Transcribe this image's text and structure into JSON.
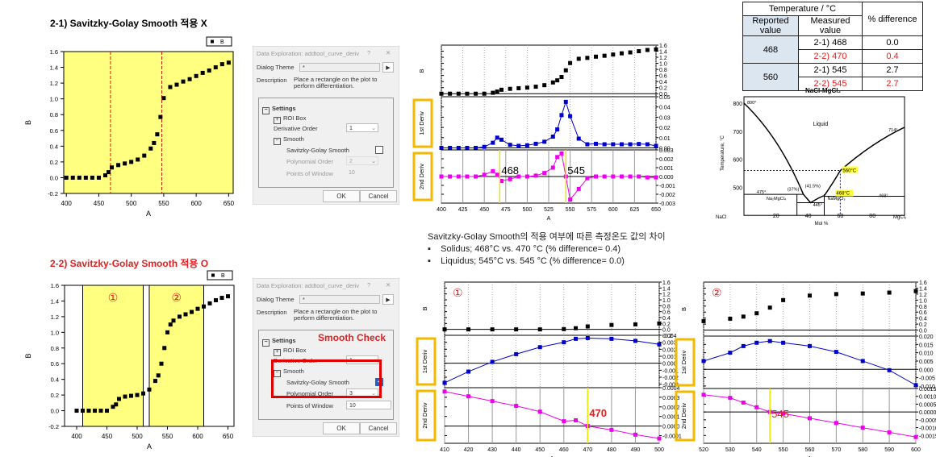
{
  "section1": {
    "title": "2-1) Savitzky-Golay  Smooth 적용 X"
  },
  "section2": {
    "title": "2-2) Savitzky-Golay  Smooth 적용 O"
  },
  "dialog1": {
    "title": "Data Exploration: addtool_curve_deriv",
    "help": "?",
    "close": "✕",
    "theme_label": "Dialog Theme",
    "theme_value": "*",
    "description_label": "Description",
    "description": "Place a rectangle on the plot to perform differentiation.",
    "settings": "Settings",
    "roi": "ROI Box",
    "deriv_label": "Derivative Order",
    "deriv_value": "1",
    "smooth": "Smooth",
    "sg_label": "Savitzky-Golay Smooth",
    "sg_checked": false,
    "poly_label": "Polynomial Order",
    "poly_value": "2",
    "window_label": "Points of Window",
    "window_value": "10",
    "ok": "OK",
    "cancel": "Cancel"
  },
  "dialog2": {
    "title": "Data Exploration: addtool_curve_deriv",
    "help": "?",
    "close": "✕",
    "theme_label": "Dialog Theme",
    "theme_value": "*",
    "description_label": "Description",
    "description": "Place a rectangle on the plot to perform differentiation.",
    "settings": "Settings",
    "roi": "ROI Box",
    "deriv_label": "Derivative Order",
    "deriv_value": "1",
    "smooth": "Smooth",
    "sg_label": "Savitzky-Golay Smooth",
    "sg_checked": true,
    "poly_label": "Polynomial Order",
    "poly_value": "3",
    "window_label": "Points of Window",
    "window_value": "10",
    "ok": "OK",
    "cancel": "Cancel",
    "annotation": "Smooth Check"
  },
  "notes": {
    "heading": "Savitzky-Golay Smooth의 적용 여부에 따른 측정온도 값의 차이",
    "items": [
      "Solidus; 468°C vs. 470 °C (% difference= 0.4)",
      "Liquidus; 545°C vs. 545 °C (% difference= 0.0)"
    ]
  },
  "table": {
    "header": "Temperature / °C",
    "col_reported": "Reported value",
    "col_measured": "Measured value",
    "col_diff": "% difference",
    "rows": [
      {
        "reported": "468",
        "measured": [
          "2-1) 468",
          "2-2) 470"
        ],
        "diff": [
          "0.0",
          "0.4"
        ]
      },
      {
        "reported": "560",
        "measured": [
          "2-1) 545",
          "2-2) 545"
        ],
        "diff": [
          "2.7",
          "2.7"
        ]
      }
    ]
  },
  "phase": {
    "title": "NaCl-MgCl₂",
    "ylabel": "Temperature, °C",
    "xlabel": "Mol %",
    "left": "NaCl",
    "right": "MgCl₂",
    "yticks": [
      "800",
      "700",
      "600",
      "500"
    ],
    "xticks": [
      "20",
      "40",
      "60",
      "80"
    ],
    "liquid": "Liquid",
    "labels": [
      "800°",
      "714°",
      "475°",
      "(37%)",
      "(41.5%)",
      "445°",
      "468°",
      "Na₂MgCl₄",
      "NaMgCl₃"
    ],
    "mark_liq": "560°C",
    "mark_sol": "468°C",
    "mark_color": "#ffff33",
    "guide_color": "#0000ff"
  },
  "colors": {
    "yellow": "#ffff80",
    "black": "#000000",
    "blue": "#0000cc",
    "magenta": "#ee00ee",
    "red": "#e02020",
    "orange": "#f5b800"
  },
  "chart_data": [
    {
      "id": "c1",
      "type": "scatter",
      "xlabel": "A",
      "ylabel": "B",
      "legend": "B",
      "xlim": [
        396,
        657
      ],
      "ylim": [
        -0.2,
        1.6
      ],
      "xticks": [
        400,
        450,
        500,
        550,
        600,
        650
      ],
      "yticks": [
        "-0.2",
        "0.0",
        "0.2",
        "0.4",
        "0.6",
        "0.8",
        "1.0",
        "1.2",
        "1.4",
        "1.6"
      ],
      "x": [
        400,
        410,
        420,
        430,
        440,
        450,
        460,
        465,
        470,
        480,
        490,
        500,
        510,
        520,
        530,
        535,
        540,
        545,
        550,
        560,
        570,
        580,
        590,
        600,
        610,
        620,
        630,
        640,
        650
      ],
      "y": [
        0,
        0,
        0,
        0,
        0,
        0,
        0.03,
        0.07,
        0.13,
        0.16,
        0.18,
        0.2,
        0.23,
        0.28,
        0.37,
        0.44,
        0.55,
        0.77,
        1.01,
        1.15,
        1.18,
        1.22,
        1.25,
        1.29,
        1.33,
        1.36,
        1.4,
        1.44,
        1.46
      ],
      "vlines": [
        468,
        547
      ]
    },
    {
      "id": "c2",
      "type": "scatter",
      "xlabel": "A",
      "ylabel": "B",
      "legend": "B",
      "xlim": [
        380,
        660
      ],
      "ylim": [
        -0.2,
        1.6
      ],
      "xticks": [
        400,
        450,
        500,
        550,
        600,
        650
      ],
      "yticks": [
        "-0.2",
        "0.0",
        "0.2",
        "0.4",
        "0.6",
        "0.8",
        "1.0",
        "1.2",
        "1.4",
        "1.6"
      ],
      "x": [
        400,
        410,
        420,
        430,
        440,
        450,
        460,
        465,
        470,
        480,
        490,
        500,
        510,
        520,
        530,
        535,
        540,
        545,
        550,
        555,
        560,
        570,
        580,
        590,
        600,
        610,
        620,
        630,
        640,
        650
      ],
      "y": [
        0,
        0,
        0,
        0,
        0,
        0,
        0.05,
        0.08,
        0.15,
        0.18,
        0.19,
        0.2,
        0.22,
        0.27,
        0.38,
        0.45,
        0.6,
        0.8,
        1.0,
        1.1,
        1.15,
        1.2,
        1.23,
        1.26,
        1.3,
        1.33,
        1.37,
        1.41,
        1.44,
        1.46
      ],
      "regions": [
        [
          410,
          510
        ],
        [
          520,
          610
        ]
      ],
      "region_labels": [
        "①",
        "②"
      ]
    },
    {
      "id": "c3",
      "type": "line",
      "xlabel": "A",
      "xlim": [
        400,
        650
      ],
      "xticks": [
        400,
        425,
        450,
        475,
        500,
        525,
        550,
        575,
        600,
        625,
        650
      ],
      "x": [
        400,
        410,
        420,
        430,
        440,
        450,
        460,
        465,
        470,
        480,
        490,
        500,
        510,
        520,
        530,
        535,
        540,
        545,
        550,
        560,
        570,
        580,
        590,
        600,
        610,
        620,
        630,
        640,
        650
      ],
      "panels": [
        {
          "ylabel": "B",
          "ylim": [
            -0.1,
            1.6
          ],
          "yticks": [
            0,
            0.2,
            0.4,
            0.6,
            0.8,
            1.0,
            1.2,
            1.4,
            1.6
          ],
          "fmt": 1,
          "line": false,
          "color": "#000000",
          "y": [
            0,
            0,
            0,
            0,
            0,
            0,
            0.03,
            0.07,
            0.13,
            0.16,
            0.18,
            0.2,
            0.23,
            0.28,
            0.37,
            0.44,
            0.55,
            0.77,
            1.01,
            1.15,
            1.18,
            1.22,
            1.25,
            1.29,
            1.33,
            1.36,
            1.4,
            1.44,
            1.46
          ]
        },
        {
          "ylabel": "1st Deriv",
          "ylim": [
            -0.002,
            0.05
          ],
          "yticks": [
            0,
            0.01,
            0.02,
            0.03,
            0.04,
            0.05
          ],
          "fmt": 2,
          "line": true,
          "color": "#0000cc",
          "y": [
            0,
            0,
            0,
            0,
            0,
            0.001,
            0.005,
            0.01,
            0.008,
            0.003,
            0.002,
            0.0025,
            0.004,
            0.006,
            0.011,
            0.018,
            0.032,
            0.045,
            0.031,
            0.009,
            0.0035,
            0.004,
            0.0035,
            0.0035,
            0.0035,
            0.0035,
            0.0038,
            0.0035,
            0.002
          ]
        },
        {
          "ylabel": "2nd Deriv",
          "ylim": [
            -0.003,
            0.003
          ],
          "yticks": [
            -0.003,
            -0.002,
            -0.001,
            0,
            0.001,
            0.002,
            0.003
          ],
          "fmt": 3,
          "line": true,
          "color": "#ee00ee",
          "y": [
            0,
            0,
            0,
            0,
            0,
            0.0002,
            0.0006,
            0.0002,
            -0.0005,
            -0.0003,
            0,
            0,
            0.0001,
            0.0004,
            0.001,
            0.0022,
            0.0026,
            0,
            -0.0026,
            -0.0014,
            -0.0002,
            0,
            0,
            0,
            0,
            0,
            0,
            -0.0001,
            -0.0001
          ],
          "marks": [
            {
              "x": 468,
              "label": "468"
            },
            {
              "x": 545,
              "label": "545"
            }
          ],
          "mark_color": "#000000"
        }
      ]
    },
    {
      "id": "c4",
      "type": "line",
      "xlabel": "A",
      "xlim": [
        410,
        500
      ],
      "xticks": [
        410,
        420,
        430,
        440,
        450,
        460,
        470,
        480,
        490,
        500
      ],
      "tag": "①",
      "x": [
        410,
        420,
        430,
        440,
        450,
        460,
        465,
        470,
        480,
        490,
        500
      ],
      "panels": [
        {
          "ylabel": "B",
          "ylim": [
            -0.2,
            1.6
          ],
          "yticks": [
            -0.2,
            0,
            0.2,
            0.4,
            0.6,
            0.8,
            1.0,
            1.2,
            1.4,
            1.6
          ],
          "fmt": 1,
          "line": false,
          "color": "#000000",
          "y": [
            0,
            0,
            0,
            0,
            0,
            0.01,
            0.04,
            0.1,
            0.15,
            0.17,
            0.2
          ]
        },
        {
          "ylabel": "1st Deriv",
          "ylim": [
            -0.0035,
            0.004
          ],
          "yticks": [
            -0.003,
            -0.002,
            -0.001,
            0,
            0.001,
            0.002,
            0.003,
            0.004
          ],
          "fmt": 3,
          "line": true,
          "color": "#0000cc",
          "y": [
            -0.0028,
            -0.0012,
            0.0002,
            0.0013,
            0.0023,
            0.003,
            0.0035,
            0.0036,
            0.0035,
            0.0032,
            0.0027
          ]
        },
        {
          "ylabel": "2nd Deriv",
          "ylim": [
            -0.00018,
            0.0004
          ],
          "yticks": [
            -0.0001,
            0,
            0.0001,
            0.0002,
            0.0003,
            0.0004
          ],
          "fmt": 4,
          "line": true,
          "color": "#ee00ee",
          "y": [
            0.00036,
            0.00031,
            0.00026,
            0.00021,
            0.00015,
            5e-05,
            6e-05,
            0,
            -4e-05,
            -9e-05,
            -0.00013
          ],
          "marks": [
            {
              "x": 470,
              "label": "470"
            }
          ],
          "mark_color": "#e02020"
        }
      ]
    },
    {
      "id": "c5",
      "type": "line",
      "xlabel": "A",
      "xlim": [
        520,
        600
      ],
      "xticks": [
        520,
        530,
        540,
        550,
        560,
        570,
        580,
        590,
        600
      ],
      "tag": "②",
      "x": [
        520,
        530,
        535,
        540,
        545,
        550,
        560,
        570,
        580,
        590,
        600
      ],
      "panels": [
        {
          "ylabel": "B",
          "ylim": [
            -0.2,
            1.6
          ],
          "yticks": [
            0,
            0.2,
            0.4,
            0.6,
            0.8,
            1.0,
            1.2,
            1.4,
            1.6
          ],
          "fmt": 1,
          "line": false,
          "color": "#000000",
          "y": [
            0.3,
            0.38,
            0.45,
            0.56,
            0.75,
            1.0,
            1.15,
            1.2,
            1.22,
            1.25,
            1.3
          ]
        },
        {
          "ylabel": "1st Deriv",
          "ylim": [
            -0.0115,
            0.02
          ],
          "yticks": [
            -0.01,
            -0.005,
            0,
            0.005,
            0.01,
            0.015,
            0.02
          ],
          "fmt": 3,
          "line": true,
          "color": "#0000cc",
          "y": [
            0.005,
            0.01,
            0.014,
            0.016,
            0.017,
            0.016,
            0.014,
            0.0105,
            0.005,
            -0.0005,
            -0.0095
          ]
        },
        {
          "ylabel": "2nd Deriv",
          "ylim": [
            -0.002,
            0.0015
          ],
          "yticks": [
            -0.0015,
            -0.001,
            -0.0005,
            0,
            0.0005,
            0.001,
            0.0015
          ],
          "fmt": 4,
          "line": true,
          "color": "#ee00ee",
          "y": [
            0.0011,
            0.0009,
            0.0006,
            0.0003,
            0,
            -0.0001,
            -0.0004,
            -0.0007,
            -0.001,
            -0.0013,
            -0.0016
          ],
          "marks": [
            {
              "x": 545,
              "label": "545"
            }
          ],
          "mark_color": "#e02020"
        }
      ]
    }
  ]
}
